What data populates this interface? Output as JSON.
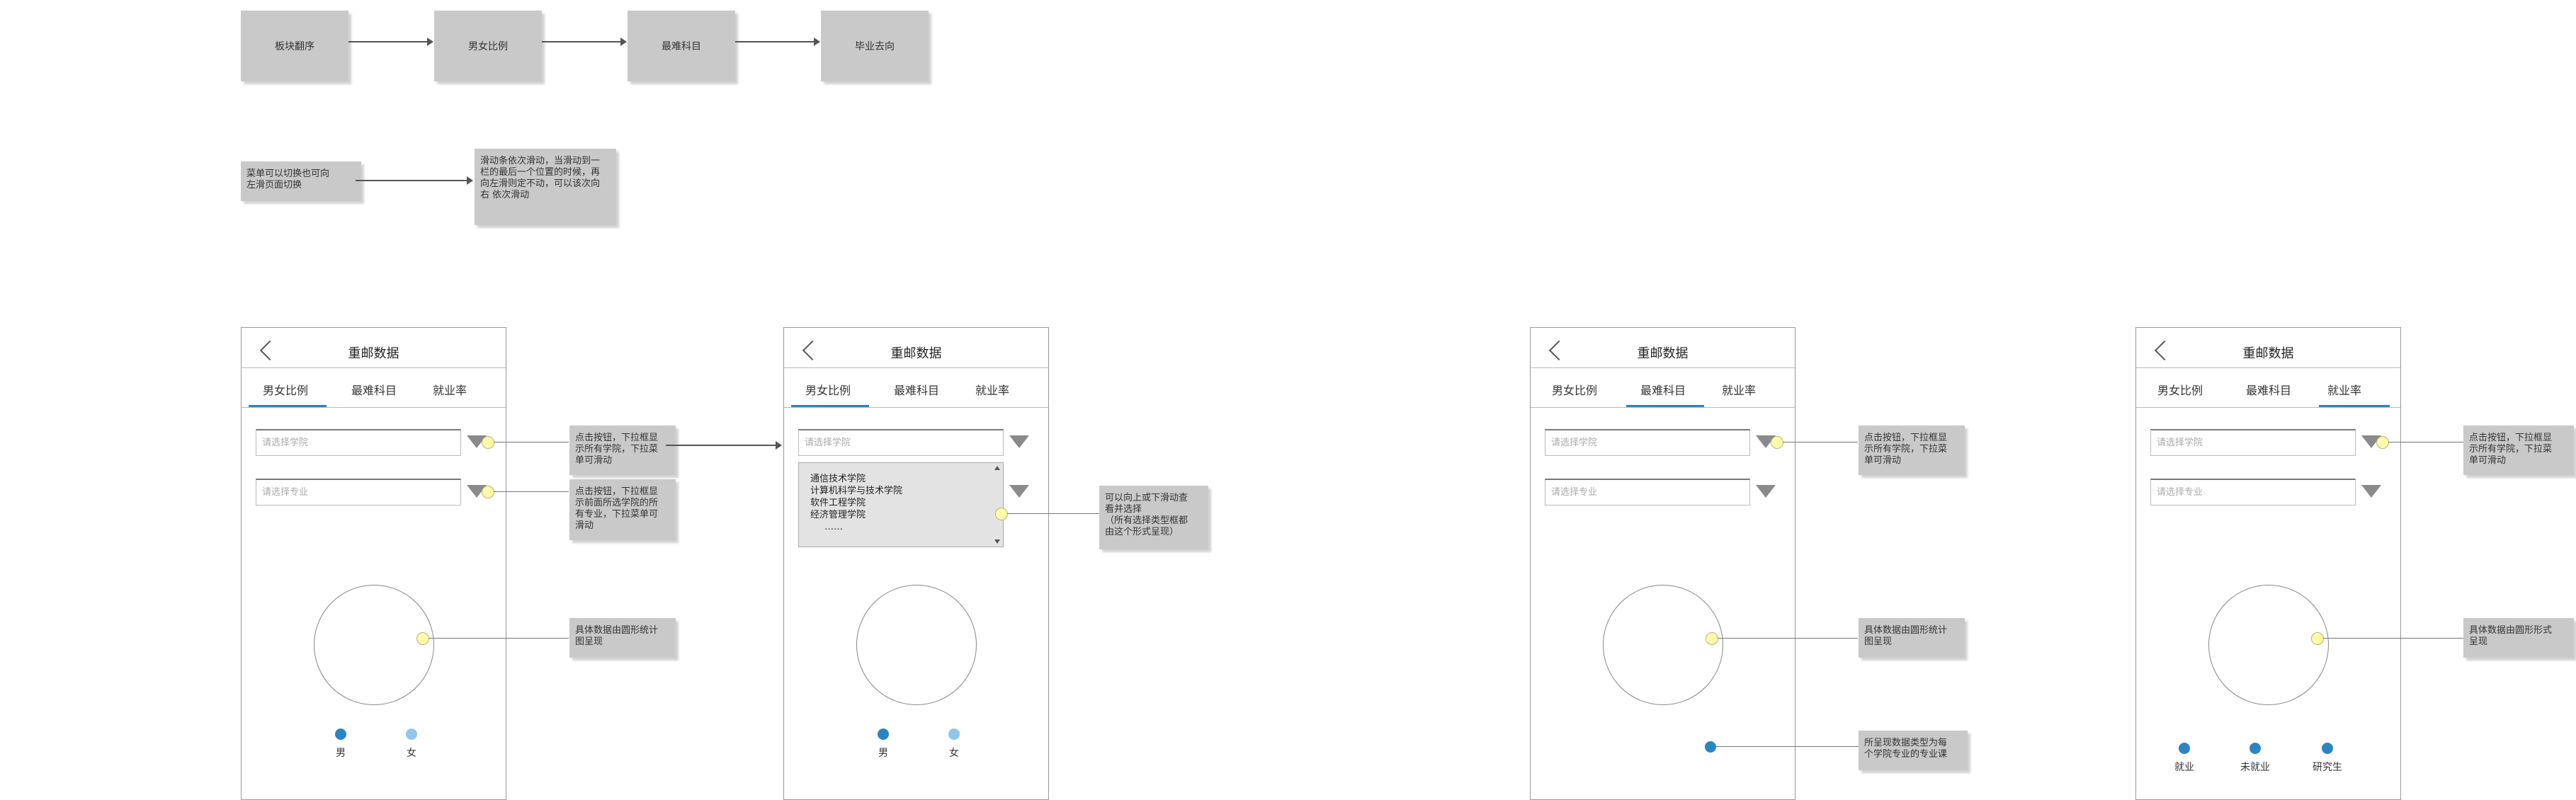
{
  "colors": {
    "box": "#c9c9c9",
    "accent": "#2a85c2",
    "light_blue": "#8fc6ee",
    "marker_yellow": "#fffba8"
  },
  "flow": {
    "steps": [
      "板块翻序",
      "男女比例",
      "最难科目",
      "毕业去向"
    ]
  },
  "notes": {
    "menu_switch": "菜单可以切换也可向\n左滑页面切换",
    "scroll_rule": "滑动条依次滑动，当滑动到一\n栏的最后一个位置的时候，再\n向左滑则定不动，可以该次向\n右 依次滑动",
    "college_dropdown": "点击按钮，下拉框显\n示所有学院，下拉菜\n单可滑动",
    "major_dropdown": "点击按钮，下拉框显\n示前面所选学院的所\n有专业，下拉菜单可\n滑动",
    "pie_chart": "具体数据由圆形统计\n图呈现",
    "scroll_select": "可以向上或下滑动查\n看并选择\n（所有选择类型框都\n由这个形式呈现）",
    "college_dropdown_3": "点击按钮，下拉框显\n示所有学院，下拉菜\n单可滑动",
    "pie_chart_3": "具体数据由圆形统计\n图呈现",
    "bar_type": "所呈现数据类型为每\n个学院专业的专业课",
    "college_dropdown_4": "点击按钮，下拉框显\n示所有学院，下拉菜\n单可滑动",
    "pie_chart_4": "具体数据由圆形形式\n呈现"
  },
  "screens": [
    {
      "title": "重邮数据",
      "tabs": [
        "男女比例",
        "最难科目",
        "就业率"
      ],
      "active_tab": 0,
      "college_placeholder": "请选择学院",
      "major_placeholder": "请选择专业",
      "legend": [
        "男",
        "女"
      ]
    },
    {
      "title": "重邮数据",
      "tabs": [
        "男女比例",
        "最难科目",
        "就业率"
      ],
      "active_tab": 0,
      "college_placeholder": "请选择学院",
      "dropdown_items": [
        "通信技术学院",
        "计算机科学与技术学院",
        "软件工程学院",
        "经济管理学院",
        "……"
      ],
      "legend": [
        "男",
        "女"
      ]
    },
    {
      "title": "重邮数据",
      "tabs": [
        "男女比例",
        "最难科目",
        "就业率"
      ],
      "active_tab": 1,
      "college_placeholder": "请选择学院",
      "major_placeholder": "请选择专业"
    },
    {
      "title": "重邮数据",
      "tabs": [
        "男女比例",
        "最难科目",
        "就业率"
      ],
      "active_tab": 2,
      "college_placeholder": "请选择学院",
      "major_placeholder": "请选择专业",
      "legend": [
        "就业",
        "未就业",
        "研究生"
      ]
    }
  ]
}
